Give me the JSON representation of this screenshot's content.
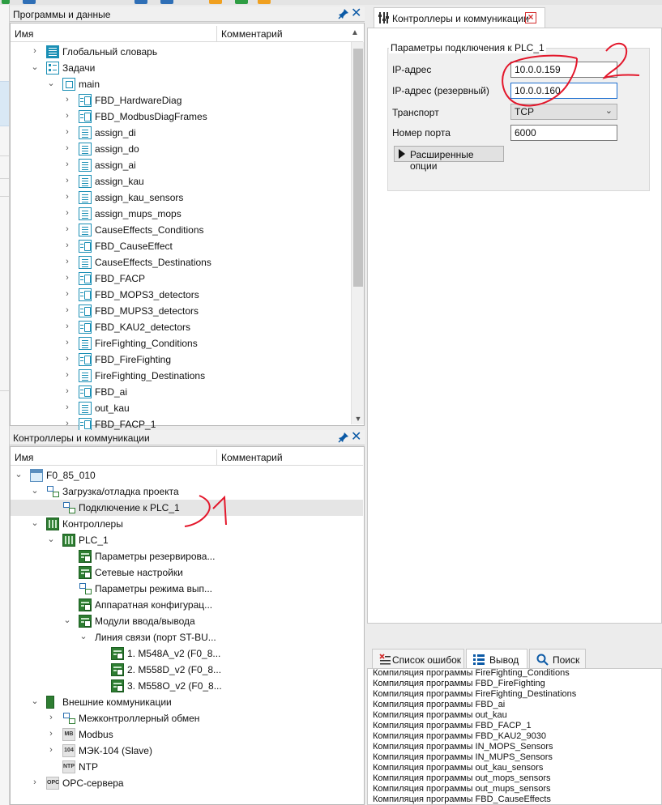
{
  "top_panel": {
    "title": "Программы и данные",
    "col_name": "Имя",
    "col_comment": "Комментарий",
    "rows": [
      {
        "label": "Глобальный словарь",
        "icon": "dictionary-icon"
      },
      {
        "label": "Задачи",
        "icon": "tasks-icon"
      },
      {
        "label": "main",
        "icon": "task-main-icon"
      },
      {
        "label": "FBD_HardwareDiag",
        "icon": "fbd-program-icon"
      },
      {
        "label": "FBD_ModbusDiagFrames",
        "icon": "fbd-program-icon"
      },
      {
        "label": "assign_di",
        "icon": "st-program-icon"
      },
      {
        "label": "assign_do",
        "icon": "st-program-icon"
      },
      {
        "label": "assign_ai",
        "icon": "st-program-icon"
      },
      {
        "label": "assign_kau",
        "icon": "st-program-icon"
      },
      {
        "label": "assign_kau_sensors",
        "icon": "st-program-icon"
      },
      {
        "label": "assign_mups_mops",
        "icon": "st-program-icon"
      },
      {
        "label": "CauseEffects_Conditions",
        "icon": "st-program-icon"
      },
      {
        "label": "FBD_CauseEffect",
        "icon": "fbd-program-icon"
      },
      {
        "label": "CauseEffects_Destinations",
        "icon": "st-program-icon"
      },
      {
        "label": "FBD_FACP",
        "icon": "fbd-program-icon"
      },
      {
        "label": "FBD_MOPS3_detectors",
        "icon": "fbd-program-icon"
      },
      {
        "label": "FBD_MUPS3_detectors",
        "icon": "fbd-program-icon"
      },
      {
        "label": "FBD_KAU2_detectors",
        "icon": "fbd-program-icon"
      },
      {
        "label": "FireFighting_Conditions",
        "icon": "st-program-icon"
      },
      {
        "label": "FBD_FireFighting",
        "icon": "fbd-program-icon"
      },
      {
        "label": "FireFighting_Destinations",
        "icon": "st-program-icon"
      },
      {
        "label": "FBD_ai",
        "icon": "fbd-program-icon"
      },
      {
        "label": "out_kau",
        "icon": "st-program-icon"
      },
      {
        "label": "FBD_FACP_1",
        "icon": "fbd-program-icon"
      }
    ]
  },
  "bottom_panel": {
    "title": "Контроллеры и коммуникации",
    "col_name": "Имя",
    "col_comment": "Комментарий",
    "rows": [
      {
        "label": "F0_85_010",
        "icon": "project-icon"
      },
      {
        "label": "Загрузка/отладка проекта",
        "icon": "network-icon"
      },
      {
        "label": "Подключение к PLC_1",
        "icon": "network-icon"
      },
      {
        "label": "Контроллеры",
        "icon": "plc-icon"
      },
      {
        "label": "PLC_1",
        "icon": "plc-icon"
      },
      {
        "label": "Параметры резервирова...",
        "icon": "module-icon"
      },
      {
        "label": "Сетевые настройки",
        "icon": "module-icon"
      },
      {
        "label": "Параметры режима вып...",
        "icon": "network-icon"
      },
      {
        "label": "Аппаратная конфигурац...",
        "icon": "module-icon"
      },
      {
        "label": "Модули ввода/вывода",
        "icon": "module-icon"
      },
      {
        "label": "Линия связи (порт ST-BU...",
        "icon": ""
      },
      {
        "label": "1. M548A_v2 (F0_8...",
        "icon": "module-icon"
      },
      {
        "label": "2. M558D_v2 (F0_8...",
        "icon": "module-icon"
      },
      {
        "label": "3. M558O_v2 (F0_8...",
        "icon": "module-icon"
      },
      {
        "label": "Внешние коммуникации",
        "icon": "ext-comm-icon"
      },
      {
        "label": "Межконтроллерный обмен",
        "icon": "network-icon"
      },
      {
        "label": "Modbus",
        "icon": "modbus-icon"
      },
      {
        "label": "МЭК-104 (Slave)",
        "icon": "iec104-icon"
      },
      {
        "label": "NTP",
        "icon": "ntp-icon"
      },
      {
        "label": "OPC-сервера",
        "icon": "opc-icon"
      }
    ],
    "icon_text": {
      "mb": "MB",
      "iec": "104",
      "ntp": "NTP",
      "opc": "OPC"
    }
  },
  "right_tab": {
    "title": "Контроллеры и коммуникации",
    "group_title": "Параметры подключения к PLC_1",
    "fields": {
      "ip_label": "IP-адрес",
      "ip_value": "10.0.0.159",
      "ip_backup_label": "IP-адрес (резервный)",
      "ip_backup_value": "10.0.0.160",
      "transport_label": "Транспорт",
      "transport_value": "TCP",
      "port_label": "Номер порта",
      "port_value": "6000"
    },
    "advanced_button": "Расширенные опции"
  },
  "output": {
    "tabs": [
      "Список ошибок",
      "Вывод",
      "Поиск"
    ],
    "lines": [
      "Компиляция программы FireFighting_Conditions",
      "Компиляция программы FBD_FireFighting",
      "Компиляция программы FireFighting_Destinations",
      "Компиляция программы FBD_ai",
      "Компиляция программы out_kau",
      "Компиляция программы FBD_FACP_1",
      "Компиляция программы FBD_KAU2_9030",
      "Компиляция программы IN_MOPS_Sensors",
      "Компиляция программы IN_MUPS_Sensors",
      "Компиляция программы out_kau_sensors",
      "Компиляция программы out_mops_sensors",
      "Компиляция программы out_mups_sensors",
      "Компиляция программы FBD_CauseEffects"
    ]
  },
  "colors": {
    "accent": "#1a8fb5",
    "annotation": "#e3172b",
    "plc": "#2e7d32"
  }
}
